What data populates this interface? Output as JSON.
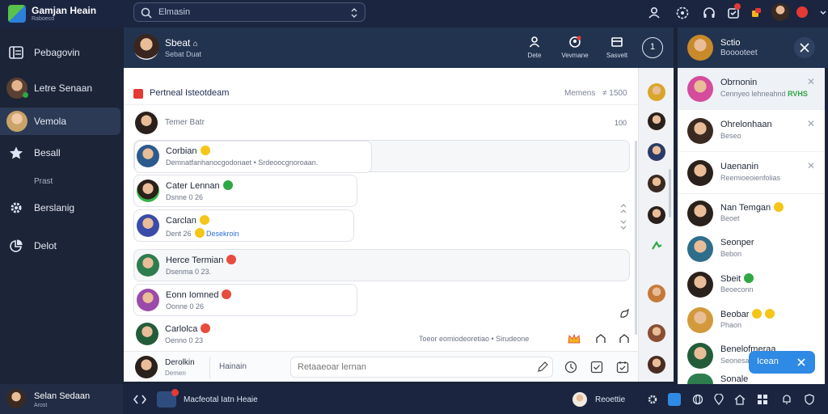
{
  "app": {
    "title": "Gamjan Heain",
    "subtitle": "Raboecd"
  },
  "search": {
    "value": "Elmasin"
  },
  "sidebar": {
    "items": [
      {
        "label": "Pebagovin",
        "icon": "list-icon"
      },
      {
        "label": "Letre Senaan",
        "icon": "avatar"
      },
      {
        "label": "Vemola",
        "icon": "avatar"
      },
      {
        "label": "Besall",
        "icon": "star-icon"
      },
      {
        "label": "Prast",
        "icon": ""
      },
      {
        "label": "Berslanig",
        "icon": "settings-icon"
      },
      {
        "label": "Delot",
        "icon": "chart-icon"
      }
    ]
  },
  "chat": {
    "header": {
      "title": "Sbeat",
      "subtitle": "Sebat Duat"
    },
    "actions": [
      {
        "label": "Dete",
        "icon": "user-icon"
      },
      {
        "label": "Vevmane",
        "icon": "add-user-icon"
      },
      {
        "label": "Sasvelt",
        "icon": "window-icon"
      }
    ],
    "pinned": {
      "title": "Pertneal Isteotdeam",
      "meta": "Memens",
      "count": "1500"
    },
    "thread": {
      "title": "Temer Batr",
      "count": "100"
    },
    "messages": [
      {
        "name": "Corbian",
        "text": "Demnatfanhanocgodonaet • Srdeoocgnoroaan.",
        "emoji_color": "#f5c518"
      },
      {
        "name": "Cater Lennan",
        "text": "Dsnne 0 26",
        "emoji_color": "#2ea843"
      },
      {
        "name": "Carclan",
        "text": "Dent 26",
        "link": "Desekroin",
        "emoji_color": "#f5c518"
      },
      {
        "name": "Herce Termian",
        "text": "Dsenma 0 23.",
        "emoji_color": "#e74c3c"
      },
      {
        "name": "Eonn Iomned",
        "text": "Oonne 0 26",
        "emoji_color": "#e74c3c"
      },
      {
        "name": "Carlolca",
        "text": "Oenno 0 23",
        "emoji_color": "#e74c3c"
      }
    ],
    "footer_note": "Toeor eomiodeoretiao • Sirudeone",
    "compose": {
      "name": "Derolkin",
      "sub": "Demen",
      "tab": "Hainain",
      "placeholder": "Retaaeoar lernan"
    }
  },
  "right_panel": {
    "header": {
      "title": "Sctio",
      "subtitle": "Booooteet"
    },
    "items": [
      {
        "name": "Obrnonin",
        "sub": "Cennyeo lehneahnd",
        "extra": "RVHS"
      },
      {
        "name": "Ohrelonhaan",
        "sub": "Beseo"
      },
      {
        "name": "Uaenanin",
        "sub": "Reemioeoienfolias"
      },
      {
        "name": "Nan Temgan",
        "sub": "Beoet"
      },
      {
        "name": "Seonper",
        "sub": "Bebon"
      },
      {
        "name": "Sbeit",
        "sub": "Beoeconn"
      },
      {
        "name": "Beobar",
        "sub": "Phaon"
      },
      {
        "name": "Benelofmeraa",
        "sub": "Seonesan"
      },
      {
        "name": "Sonale",
        "sub": ""
      }
    ],
    "follow_button": "Icean"
  },
  "bottombar": {
    "user": {
      "name": "Selan Sedaan",
      "sub": "Arost"
    },
    "tab": "Macfeotal Iatn Heaie",
    "right": "Reoettie"
  },
  "colors": {
    "accent": "#2f8ae6",
    "sidebar": "#1c2437",
    "header": "#22334f",
    "badge": "#e53935"
  }
}
